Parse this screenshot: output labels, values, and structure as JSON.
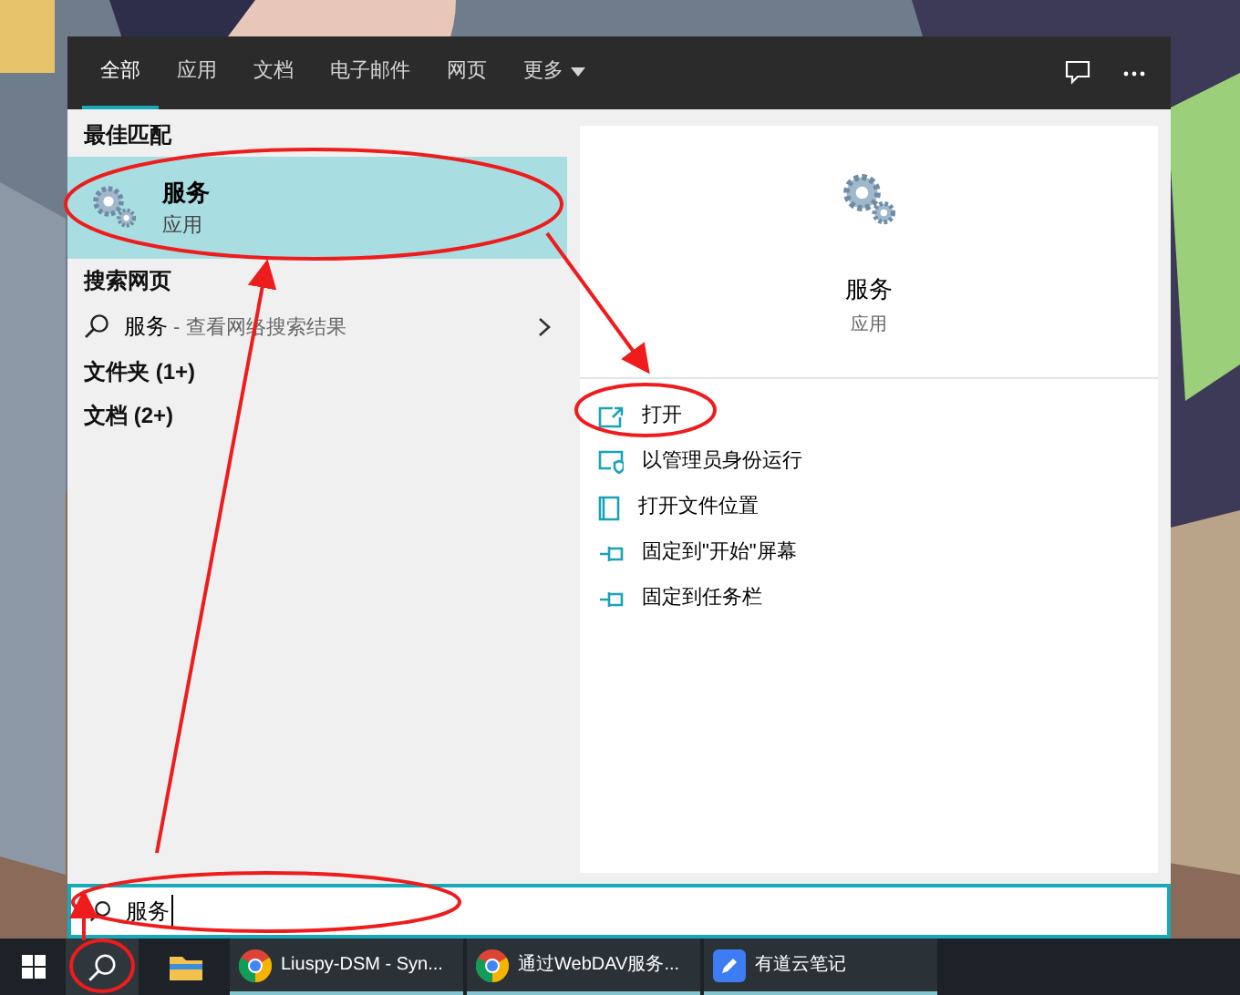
{
  "tabs": [
    {
      "label": "全部",
      "selected": true
    },
    {
      "label": "应用",
      "selected": false
    },
    {
      "label": "文档",
      "selected": false
    },
    {
      "label": "电子邮件",
      "selected": false
    },
    {
      "label": "网页",
      "selected": false
    },
    {
      "label": "更多",
      "selected": false,
      "dropdown": true
    }
  ],
  "results": [
    {
      "kind": "heading",
      "label": "最佳匹配"
    },
    {
      "kind": "app",
      "title": "服务",
      "subtitle": "应用",
      "selected": true
    },
    {
      "kind": "heading",
      "label": "搜索网页"
    },
    {
      "kind": "web",
      "title": "服务",
      "hint": " - 查看网络搜索结果"
    },
    {
      "kind": "heading",
      "label": "文件夹 (1+)"
    },
    {
      "kind": "heading",
      "label": "文档 (2+)"
    }
  ],
  "preview": {
    "title": "服务",
    "subtitle": "应用"
  },
  "actions": [
    {
      "kind": "open",
      "label": "打开"
    },
    {
      "kind": "admin",
      "label": "以管理员身份运行"
    },
    {
      "kind": "location",
      "label": "打开文件位置"
    },
    {
      "kind": "pin",
      "label": "固定到\"开始\"屏幕"
    },
    {
      "kind": "pin",
      "label": "固定到任务栏"
    }
  ],
  "search": {
    "value": "服务"
  },
  "taskbar": [
    {
      "kind": "explorer"
    },
    {
      "kind": "chrome",
      "label": "Liuspy-DSM - Syn..."
    },
    {
      "kind": "chrome",
      "label": "通过WebDAV服务..."
    },
    {
      "kind": "note",
      "label": "有道云笔记"
    }
  ]
}
